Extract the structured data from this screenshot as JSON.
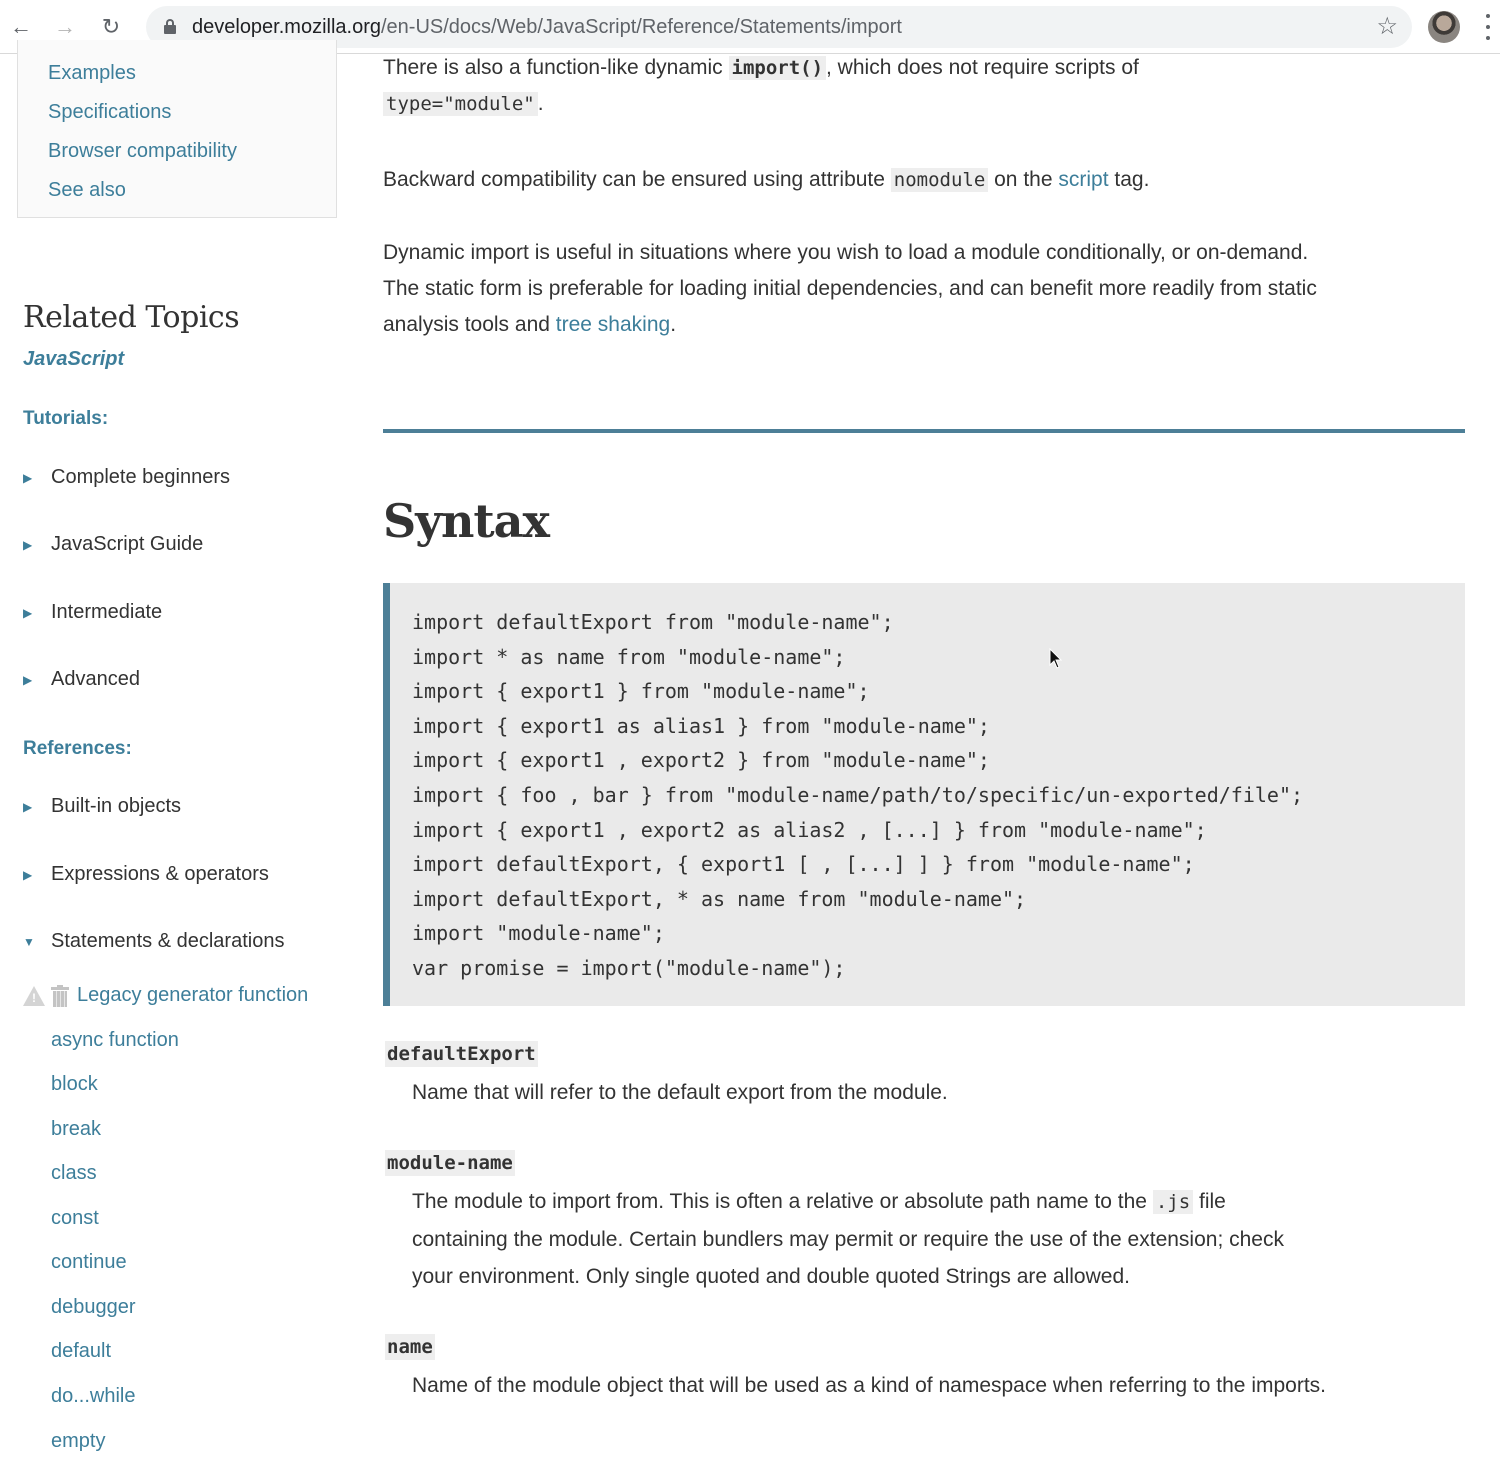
{
  "browser": {
    "url_host": "developer.mozilla.org",
    "url_path": "/en-US/docs/Web/JavaScript/Reference/Statements/import",
    "icons": {
      "back": "arrow-left-icon",
      "forward": "arrow-right-icon",
      "reload": "reload-icon",
      "lock": "lock-icon",
      "bookmark": "star-icon",
      "profile": "avatar",
      "menu": "kebab-menu-icon"
    }
  },
  "toc": {
    "items": [
      "Examples",
      "Specifications",
      "Browser compatibility",
      "See also"
    ]
  },
  "sidebar": {
    "related_title": "Related Topics",
    "topic_link": "JavaScript",
    "tutorials_heading": "Tutorials:",
    "tutorials": [
      "Complete beginners",
      "JavaScript Guide",
      "Intermediate",
      "Advanced"
    ],
    "references_heading": "References:",
    "references": [
      "Built-in objects",
      "Expressions & operators"
    ],
    "statements_label": "Statements & declarations",
    "statements": {
      "legacy_item": "Legacy generator function",
      "items": [
        "async function",
        "block",
        "break",
        "class",
        "const",
        "continue",
        "debugger",
        "default",
        "do...while",
        "empty"
      ]
    }
  },
  "content": {
    "p1": {
      "before": "There is also a function-like dynamic ",
      "code": "import()",
      "after": ", which does not require scripts of",
      "code2": "type=\"module\"",
      "end": "."
    },
    "p2": {
      "before": "Backward compatibility can be ensured using attribute ",
      "code": "nomodule",
      "middle": " on the ",
      "link": "script",
      "after": " tag."
    },
    "p3": {
      "text": "Dynamic import is useful in situations where you wish to load a module conditionally, or on-demand. The static form is preferable for loading initial dependencies, and can benefit more readily from static analysis tools and ",
      "link": "tree shaking",
      "end": "."
    },
    "syntax_heading": "Syntax",
    "code_lines": [
      "import defaultExport from \"module-name\";",
      "import * as name from \"module-name\";",
      "import { export1 } from \"module-name\";",
      "import { export1 as alias1 } from \"module-name\";",
      "import { export1 , export2 } from \"module-name\";",
      "import { foo , bar } from \"module-name/path/to/specific/un-exported/file\";",
      "import { export1 , export2 as alias2 , [...] } from \"module-name\";",
      "import defaultExport, { export1 [ , [...] ] } from \"module-name\";",
      "import defaultExport, * as name from \"module-name\";",
      "import \"module-name\";",
      "var promise = import(\"module-name\");"
    ],
    "params": [
      {
        "term": "defaultExport",
        "desc": "Name that will refer to the default export from the module."
      },
      {
        "term": "module-name",
        "desc_before": "The module to import from. This is often a relative or absolute path name to the ",
        "desc_code": ".js",
        "desc_after": " file containing the module. Certain bundlers may permit or require the use of the extension; check your environment. Only single quoted and double quoted Strings are allowed."
      },
      {
        "term": "name",
        "desc": "Name of the module object that will be used as a kind of namespace when referring to the imports."
      }
    ]
  },
  "colors": {
    "link": "#3d7e9a",
    "accent_rule": "#4d7f97",
    "code_bg": "#eaeaea",
    "text": "#333333"
  }
}
